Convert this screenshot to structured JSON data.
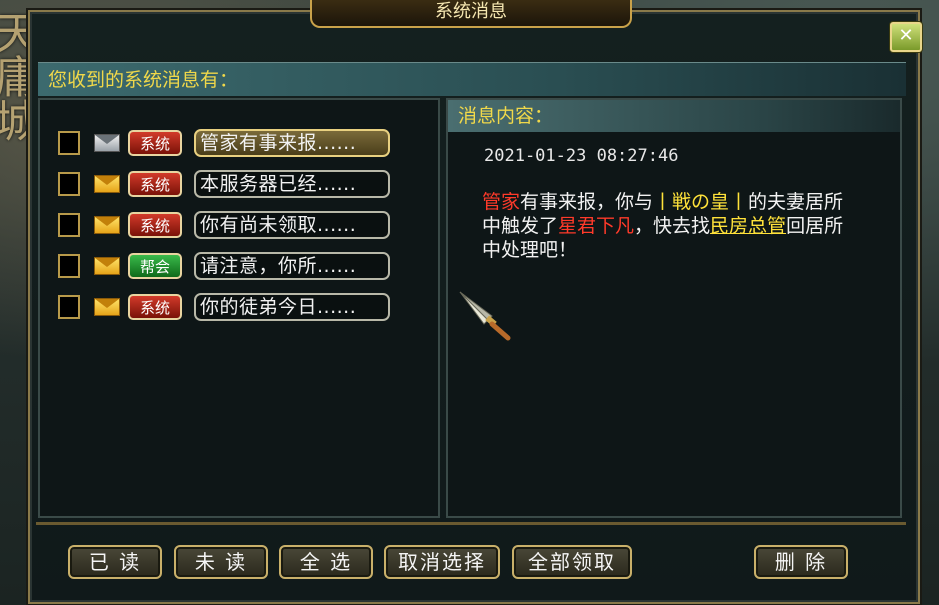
{
  "window": {
    "title": "系统消息",
    "close_symbol": "✕"
  },
  "background": {
    "vertical_text": "天庸城"
  },
  "list": {
    "header": "您收到的系统消息有：",
    "messages": [
      {
        "checked": false,
        "mail": "read",
        "tag": "系统",
        "tag_color": "red",
        "subject": "管家有事来报......",
        "selected": true
      },
      {
        "checked": false,
        "mail": "unread",
        "tag": "系统",
        "tag_color": "red",
        "subject": "本服务器已经......",
        "selected": false
      },
      {
        "checked": false,
        "mail": "unread",
        "tag": "系统",
        "tag_color": "red",
        "subject": "你有尚未领取......",
        "selected": false
      },
      {
        "checked": false,
        "mail": "unread",
        "tag": "帮会",
        "tag_color": "green",
        "subject": "请注意，你所......",
        "selected": false
      },
      {
        "checked": false,
        "mail": "unread",
        "tag": "系统",
        "tag_color": "red",
        "subject": "你的徒弟今日......",
        "selected": false
      }
    ]
  },
  "content": {
    "header": "消息内容：",
    "timestamp": "2021-01-23 08:27:46",
    "parts": [
      {
        "text": "管家",
        "style": "r"
      },
      {
        "text": "有事来报，你与",
        "style": ""
      },
      {
        "text": "丨戦の皇丨",
        "style": "y"
      },
      {
        "text": "的夫妻居所中触发了",
        "style": ""
      },
      {
        "text": "星君下凡",
        "style": "r"
      },
      {
        "text": "，快去找",
        "style": ""
      },
      {
        "text": "民房总管",
        "style": "u"
      },
      {
        "text": "回居所中处理吧！",
        "style": ""
      }
    ]
  },
  "buttons": {
    "read": "已 读",
    "unread": "未 读",
    "select_all": "全 选",
    "cancel_select": "取消选择",
    "claim_all": "全部领取",
    "delete": "删 除"
  },
  "colors": {
    "frame_gold": "#c9a24a",
    "header_yellow": "#f0d84a",
    "highlight_red": "#ff3a2a"
  }
}
